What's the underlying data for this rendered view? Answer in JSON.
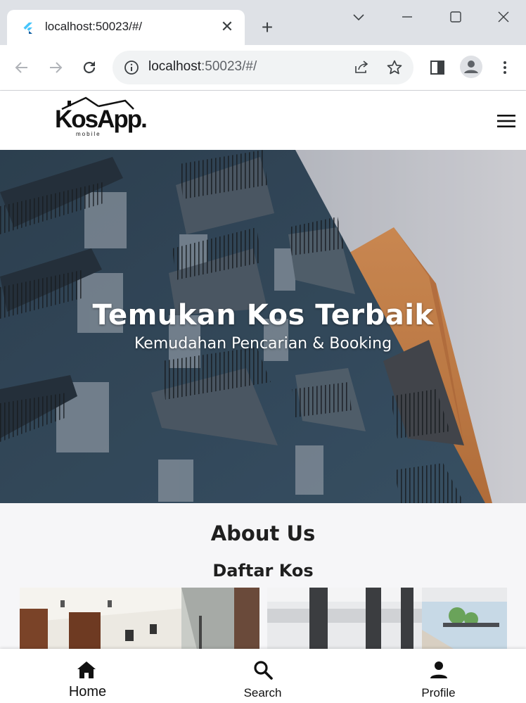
{
  "browser": {
    "tab_title": "localhost:50023/#/",
    "url_host": "localhost",
    "url_rest": ":50023/#/"
  },
  "app": {
    "logo_text": "KosApp.",
    "logo_sub": "mobile",
    "hero": {
      "title": "Temukan Kos Terbaik",
      "subtitle": "Kemudahan Pencarian & Booking"
    },
    "section_about": "About Us",
    "section_list": "Daftar Kos",
    "bottom_nav": [
      {
        "label": "Home",
        "icon": "home-icon",
        "active": true
      },
      {
        "label": "Search",
        "icon": "search-icon",
        "active": false
      },
      {
        "label": "Profile",
        "icon": "profile-icon",
        "active": false
      }
    ]
  },
  "colors": {
    "building_blue": "#3a5064",
    "building_orange": "#d98a4e",
    "chrome_bg": "#dee1e6"
  }
}
